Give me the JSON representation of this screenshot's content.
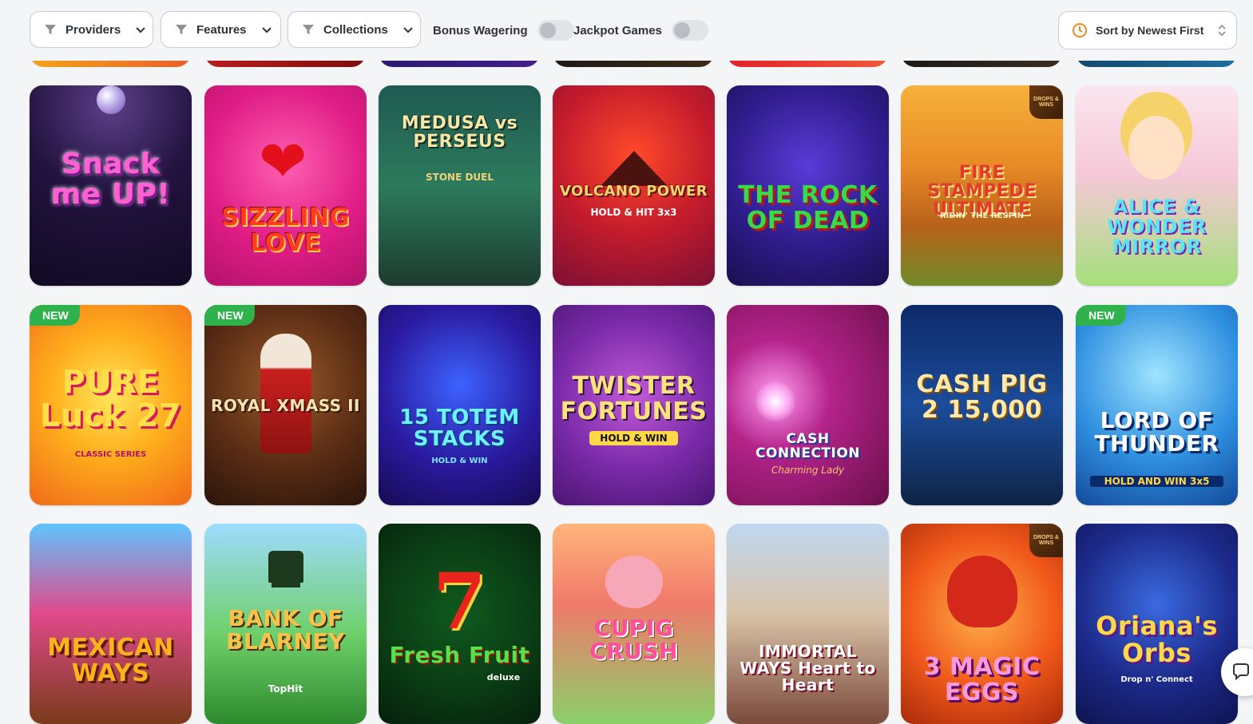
{
  "toolbar": {
    "providers_label": "Providers",
    "features_label": "Features",
    "collections_label": "Collections",
    "bonus_wagering_label": "Bonus Wagering",
    "bonus_wagering_on": false,
    "jackpot_games_label": "Jackpot Games",
    "jackpot_games_on": false,
    "sort_label": "Sort by Newest First",
    "sort_icon_color": "#f28a1e"
  },
  "colors": {
    "background": "#f4f5f7",
    "new_badge": "#2fb24c",
    "border": "#c9ccd2"
  },
  "badges": {
    "new": "NEW",
    "drops_wins": "DROPS & WINS"
  },
  "games": [
    {
      "title": "Snack me UP!",
      "subtitle": ""
    },
    {
      "title": "SIZZLING LOVE",
      "subtitle": ""
    },
    {
      "title": "MEDUSA vs PERSEUS",
      "subtitle": "STONE DUEL"
    },
    {
      "title": "VOLCANO POWER",
      "subtitle": "HOLD & HIT 3x3"
    },
    {
      "title": "THE ROCK OF DEAD",
      "subtitle": ""
    },
    {
      "title": "FIRE STAMPEDE ULTIMATE",
      "subtitle": "RIDIN' THE RESPIN"
    },
    {
      "title": "ALICE & WONDER MIRROR",
      "subtitle": ""
    },
    {
      "title": "PURE Luck 27",
      "subtitle": "CLASSIC SERIES"
    },
    {
      "title": "ROYAL XMASS II",
      "subtitle": ""
    },
    {
      "title": "15 TOTEM STACKS",
      "subtitle": "HOLD & WIN"
    },
    {
      "title": "TWISTER FORTUNES",
      "subtitle": "HOLD & WIN"
    },
    {
      "title": "CASH CONNECTION",
      "subtitle": "Charming Lady"
    },
    {
      "title": "CASH PIG 2 15,000",
      "subtitle": ""
    },
    {
      "title": "LORD OF THUNDER",
      "subtitle": "HOLD AND WIN 3x5"
    },
    {
      "title": "MEXICAN WAYS",
      "subtitle": ""
    },
    {
      "title": "BANK OF BLARNEY",
      "subtitle": "TopHit"
    },
    {
      "title": "Fresh Fruit",
      "subtitle": "deluxe"
    },
    {
      "title": "CUPIG CRUSH",
      "subtitle": ""
    },
    {
      "title": "IMMORTAL WAYS Heart to Heart",
      "subtitle": ""
    },
    {
      "title": "3 MAGIC EGGS",
      "subtitle": ""
    },
    {
      "title": "Oriana's Orbs",
      "subtitle": "Drop n' Connect"
    }
  ]
}
